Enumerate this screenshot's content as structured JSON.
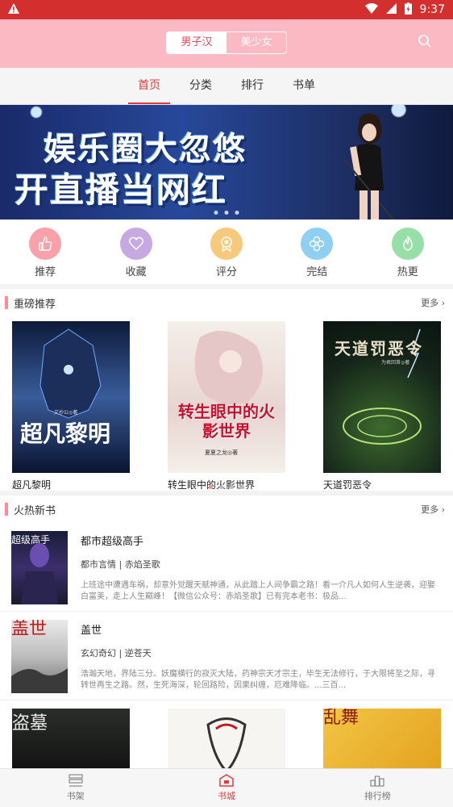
{
  "status_bar": {
    "warning_icon": "warning-icon",
    "time": "9:37"
  },
  "header": {
    "segments": [
      "男子汉",
      "美少女"
    ],
    "selected_segment": "男子汉",
    "search_icon": "search-icon",
    "accent_color": "#fbbac3"
  },
  "top_nav": {
    "tabs": [
      "首页",
      "分类",
      "排行",
      "书单"
    ],
    "active": "首页",
    "active_color": "#e03a3a"
  },
  "banner": {
    "line1": "娱乐圈大忽悠",
    "line2": "开直播当网红",
    "slide_count": 3,
    "active_slide": 1
  },
  "quick_links": [
    {
      "label": "推荐",
      "icon": "thumbs-up-icon",
      "color": "#f9a0a8"
    },
    {
      "label": "收藏",
      "icon": "heart-icon",
      "color": "#c5a9e0"
    },
    {
      "label": "评分",
      "icon": "medal-icon",
      "color": "#f7c97a"
    },
    {
      "label": "完结",
      "icon": "flower-icon",
      "color": "#8fd0f2"
    },
    {
      "label": "热更",
      "icon": "flame-icon",
      "color": "#96e0a8"
    }
  ],
  "featured": {
    "section_title": "重磅推荐",
    "more": "更多",
    "books": [
      {
        "title": "超凡黎明",
        "cover_text": "超凡黎明",
        "cover_author": "文抄公◎著"
      },
      {
        "title": "转生眼中的火影世界",
        "cover_text": "转生眼中的火影世界",
        "cover_author": "夏夏之龙◎著"
      },
      {
        "title": "天道罚恶令",
        "cover_text": "天道罚恶令",
        "cover_author": "为君回首◎著"
      }
    ],
    "page_count": 4,
    "active_page": 1
  },
  "new_books": {
    "section_title": "火热新书",
    "more": "更多",
    "books": [
      {
        "title": "都市超级高手",
        "meta": "都市言情 | 赤焰圣歌",
        "desc": "上班途中遭遇车祸，却意外觉醒天赋神通，从此踏上人间争霸之路！看一介凡人如何人生逆袭，迎娶白富美，走上人生巅峰！【微信公众号：赤焰圣歌】已有完本老书：极品...",
        "cover_text": "超级高手"
      },
      {
        "title": "盖世",
        "meta": "玄幻奇幻 | 逆苍天",
        "desc": "浩瀚天地，界陆三分。妖魔横行的寂灭大陆，药神宗天才宗主，毕生无法修行，于大限将至之际，寻转世再生之路。然，生死海深，轮回路险，因果纠缠，厄难降临。...三百...",
        "cover_text": "盖世"
      }
    ],
    "more_covers": [
      "盗墓",
      "",
      "乱舞"
    ]
  },
  "tab_bar": {
    "tabs": [
      {
        "label": "书架",
        "icon": "bookshelf-icon"
      },
      {
        "label": "书城",
        "icon": "bookstore-icon"
      },
      {
        "label": "排行榜",
        "icon": "ranking-icon"
      }
    ],
    "active": "书城",
    "active_color": "#e03a3a"
  }
}
